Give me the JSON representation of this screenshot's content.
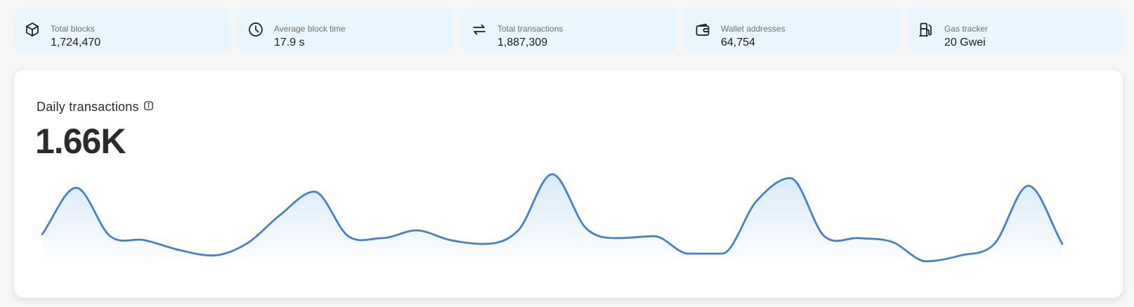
{
  "stats": [
    {
      "id": "total-blocks",
      "icon": "cube-icon",
      "label": "Total blocks",
      "value": "1,724,470"
    },
    {
      "id": "average-block-time",
      "icon": "clock-icon",
      "label": "Average block time",
      "value": "17.9 s"
    },
    {
      "id": "total-transactions",
      "icon": "arrows-swap-icon",
      "label": "Total transactions",
      "value": "1,887,309"
    },
    {
      "id": "wallet-addresses",
      "icon": "wallet-icon",
      "label": "Wallet addresses",
      "value": "64,754"
    },
    {
      "id": "gas-tracker",
      "icon": "gas-pump-icon",
      "label": "Gas tracker",
      "value": "20 Gwei"
    }
  ],
  "daily_transactions": {
    "title": "Daily transactions",
    "info_icon": "info-icon",
    "metric": "1.66K",
    "line_color": "#4580cc",
    "fill_color": "#d3e8f8"
  },
  "chart_data": {
    "type": "area",
    "title": "Daily transactions",
    "xlabel": "",
    "ylabel": "",
    "grid": false,
    "values": [
      1.55,
      1.79,
      1.54,
      1.52,
      1.47,
      1.44,
      1.5,
      1.65,
      1.77,
      1.54,
      1.53,
      1.57,
      1.52,
      1.5,
      1.57,
      1.86,
      1.58,
      1.53,
      1.54,
      1.45,
      1.45,
      1.72,
      1.84,
      1.54,
      1.53,
      1.51,
      1.41,
      1.44,
      1.5,
      1.8,
      1.5
    ]
  }
}
